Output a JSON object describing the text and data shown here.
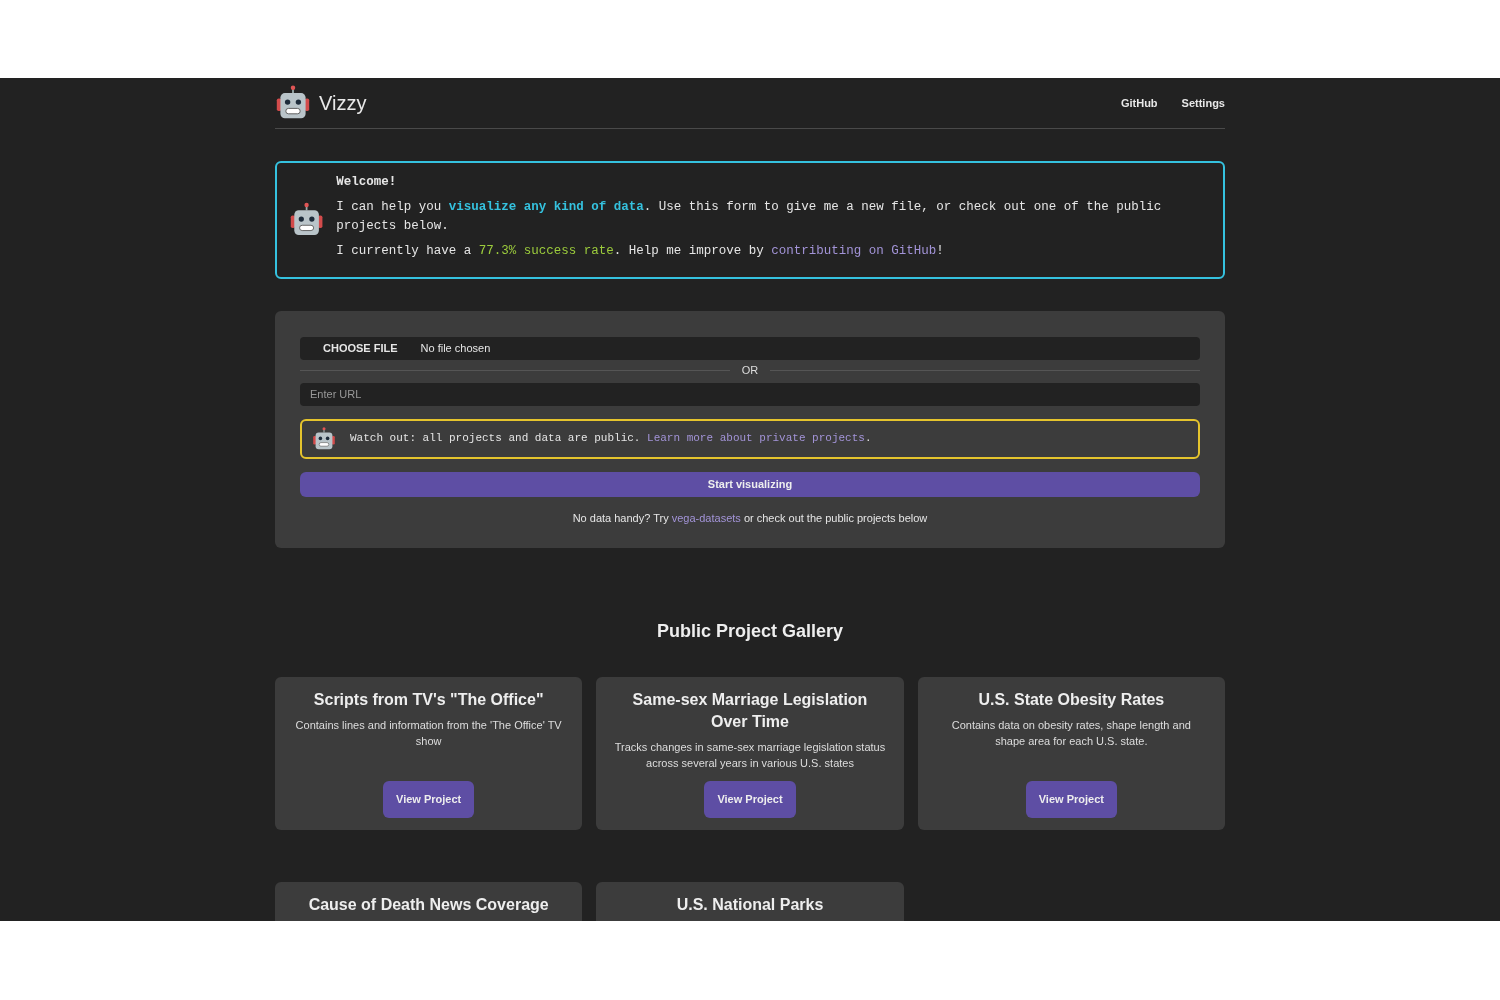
{
  "header": {
    "brand": "Vizzy",
    "nav": [
      "GitHub",
      "Settings"
    ]
  },
  "welcome": {
    "title": "Welcome!",
    "lines": [
      [
        {
          "kind": "plain",
          "text": "I can help you "
        },
        {
          "kind": "highlight",
          "text": "visualize any kind of data"
        },
        {
          "kind": "plain",
          "text": ". Use this form to give me a new file, or check out one of the public projects below."
        }
      ],
      [
        {
          "kind": "plain",
          "text": "I currently have a "
        },
        {
          "kind": "success",
          "text": "77.3% success rate"
        },
        {
          "kind": "plain",
          "text": ". Help me improve by "
        },
        {
          "kind": "link",
          "text": "contributing on GitHub"
        },
        {
          "kind": "plain",
          "text": "!"
        }
      ]
    ]
  },
  "form": {
    "file_button": "CHOOSE FILE",
    "file_status": "No file chosen",
    "divider": "OR",
    "url_placeholder": "Enter URL",
    "warning": [
      {
        "kind": "plain",
        "text": "Watch out: all projects and data are public. "
      },
      {
        "kind": "link",
        "text": "Learn more about private projects"
      },
      {
        "kind": "plain",
        "text": "."
      }
    ],
    "submit": "Start visualizing",
    "hint": [
      {
        "kind": "plain",
        "text": "No data handy? Try "
      },
      {
        "kind": "link",
        "text": "vega-datasets"
      },
      {
        "kind": "plain",
        "text": " or check out the public projects below"
      }
    ]
  },
  "gallery": {
    "title": "Public Project Gallery",
    "projects": [
      {
        "title": "Scripts from TV's \"The Office\"",
        "description": "Contains lines and information from the 'The Office' TV show",
        "button": "View Project"
      },
      {
        "title": "Same-sex Marriage Legislation Over Time",
        "description": "Tracks changes in same-sex marriage legislation status across several years in various U.S. states",
        "button": "View Project"
      },
      {
        "title": "U.S. State Obesity Rates",
        "description": "Contains data on obesity rates, shape length and shape area for each U.S. state.",
        "button": "View Project"
      },
      {
        "title": "Cause of Death News Coverage"
      },
      {
        "title": "U.S. National Parks"
      }
    ]
  }
}
